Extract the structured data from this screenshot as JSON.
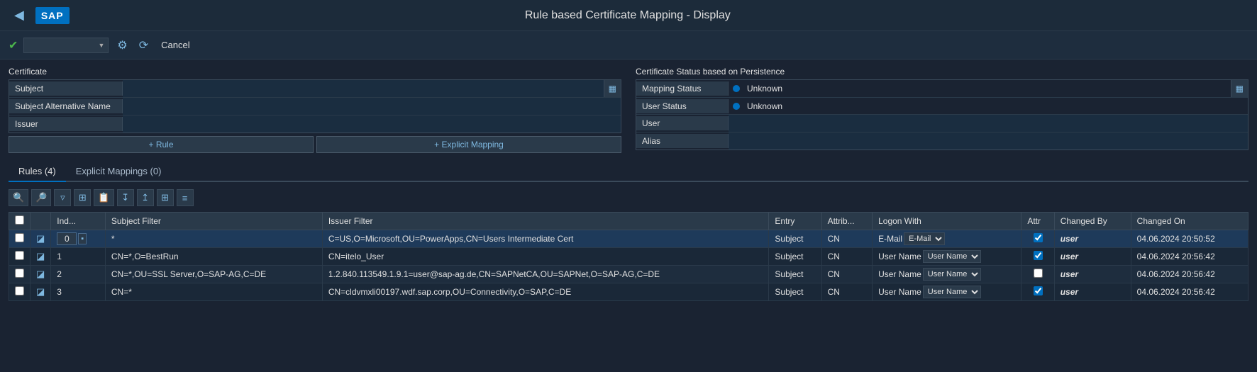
{
  "header": {
    "title": "Rule based Certificate Mapping - Display",
    "back_icon": "◀",
    "sap_logo": "SAP"
  },
  "toolbar": {
    "check_icon": "✔",
    "dropdown_placeholder": "",
    "refresh_icon": "⟳",
    "settings_icon": "⚙",
    "cancel_label": "Cancel"
  },
  "certificate_section": {
    "title": "Certificate",
    "fields": [
      {
        "label": "Subject",
        "value": ""
      },
      {
        "label": "Subject Alternative Name",
        "value": ""
      },
      {
        "label": "Issuer",
        "value": ""
      }
    ],
    "buttons": [
      {
        "label": "+ Rule"
      },
      {
        "label": "+ Explicit Mapping"
      }
    ]
  },
  "status_section": {
    "title": "Certificate Status based on Persistence",
    "fields": [
      {
        "label": "Mapping Status",
        "value": "Unknown",
        "has_dot": true
      },
      {
        "label": "User Status",
        "value": "Unknown",
        "has_dot": true
      },
      {
        "label": "User",
        "value": "",
        "is_input": true
      },
      {
        "label": "Alias",
        "value": "",
        "is_input": true
      }
    ]
  },
  "tabs": [
    {
      "label": "Rules (4)",
      "active": true
    },
    {
      "label": "Explicit Mappings (0)",
      "active": false
    }
  ],
  "table_toolbar_icons": [
    "🔍",
    "🔍",
    "▽",
    "⊞",
    "📋",
    "↙",
    "↗",
    "⊞",
    "≡"
  ],
  "table": {
    "columns": [
      {
        "label": ""
      },
      {
        "label": "Ind..."
      },
      {
        "label": "Subject Filter"
      },
      {
        "label": "Issuer Filter"
      },
      {
        "label": "Entry"
      },
      {
        "label": "Attrib..."
      },
      {
        "label": "Logon With"
      },
      {
        "label": "Attr"
      },
      {
        "label": "Changed By"
      },
      {
        "label": "Changed On"
      }
    ],
    "rows": [
      {
        "selected": true,
        "checked": false,
        "index": "0",
        "index_extra": "⊞",
        "subject_filter": "*",
        "issuer_filter": "C=US,O=Microsoft,OU=PowerApps,CN=Users Intermediate Cert",
        "entry": "Subject",
        "attrib": "CN",
        "logon_with": "E-Mail",
        "logon_with_dropdown": true,
        "attr_checked": true,
        "changed_by": "user",
        "changed_on": "04.06.2024 20:50:52"
      },
      {
        "selected": false,
        "checked": false,
        "index": "1",
        "subject_filter": "CN=*,O=BestRun",
        "issuer_filter": "CN=itelo_User",
        "entry": "Subject",
        "attrib": "CN",
        "logon_with": "User Name",
        "logon_with_dropdown": true,
        "attr_checked": true,
        "changed_by": "user",
        "changed_on": "04.06.2024 20:56:42"
      },
      {
        "selected": false,
        "checked": false,
        "index": "2",
        "subject_filter": "CN=*,OU=SSL Server,O=SAP-AG,C=DE",
        "issuer_filter": "1.2.840.113549.1.9.1=user@sap-ag.de,CN=SAPNetCA,OU=SAPNet,O=SAP-AG,C=DE",
        "entry": "Subject",
        "attrib": "CN",
        "logon_with": "User Name",
        "logon_with_dropdown": true,
        "attr_checked": false,
        "changed_by": "user",
        "changed_on": "04.06.2024 20:56:42"
      },
      {
        "selected": false,
        "checked": false,
        "index": "3",
        "subject_filter": "CN=*",
        "issuer_filter": "CN=cldvmxli00197.wdf.sap.corp,OU=Connectivity,O=SAP,C=DE",
        "entry": "Subject",
        "attrib": "CN",
        "logon_with": "User Name",
        "logon_with_dropdown": true,
        "attr_checked": true,
        "changed_by": "user",
        "changed_on": "04.06.2024 20:56:42"
      }
    ]
  }
}
